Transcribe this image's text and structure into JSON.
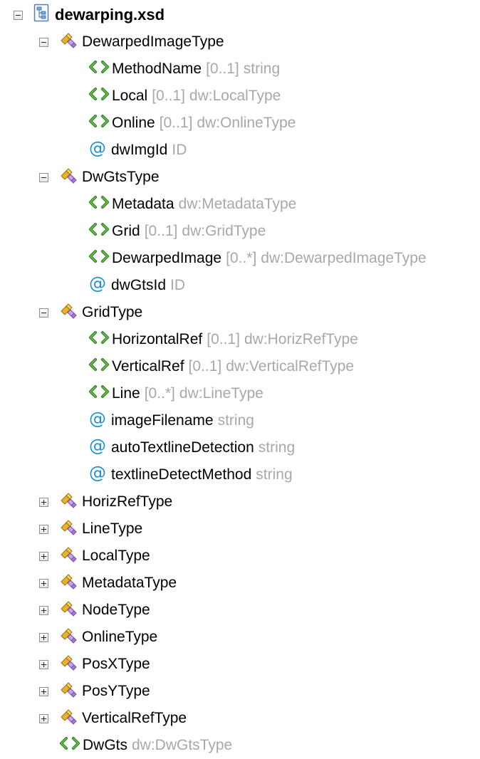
{
  "tree": {
    "root": {
      "label": "dewarping.xsd",
      "icon": "schema-file-icon"
    },
    "nodes": [
      {
        "level": 1,
        "kind": "type",
        "expander": "minus",
        "name": "DewarpedImageType",
        "mult": "",
        "type": ""
      },
      {
        "level": 2,
        "kind": "element",
        "expander": "",
        "name": "MethodName",
        "mult": "[0..1]",
        "type": "string"
      },
      {
        "level": 2,
        "kind": "element",
        "expander": "",
        "name": "Local",
        "mult": "[0..1]",
        "type": "dw:LocalType"
      },
      {
        "level": 2,
        "kind": "element",
        "expander": "",
        "name": "Online",
        "mult": "[0..1]",
        "type": "dw:OnlineType"
      },
      {
        "level": 2,
        "kind": "attribute",
        "expander": "",
        "name": "dwImgId",
        "mult": "",
        "type": "ID"
      },
      {
        "level": 1,
        "kind": "type",
        "expander": "minus",
        "name": "DwGtsType",
        "mult": "",
        "type": ""
      },
      {
        "level": 2,
        "kind": "element",
        "expander": "",
        "name": "Metadata",
        "mult": "",
        "type": "dw:MetadataType"
      },
      {
        "level": 2,
        "kind": "element",
        "expander": "",
        "name": "Grid",
        "mult": "[0..1]",
        "type": "dw:GridType"
      },
      {
        "level": 2,
        "kind": "element",
        "expander": "",
        "name": "DewarpedImage",
        "mult": "[0..*]",
        "type": "dw:DewarpedImageType"
      },
      {
        "level": 2,
        "kind": "attribute",
        "expander": "",
        "name": "dwGtsId",
        "mult": "",
        "type": "ID"
      },
      {
        "level": 1,
        "kind": "type",
        "expander": "minus",
        "name": "GridType",
        "mult": "",
        "type": ""
      },
      {
        "level": 2,
        "kind": "element",
        "expander": "",
        "name": "HorizontalRef",
        "mult": "[0..1]",
        "type": "dw:HorizRefType"
      },
      {
        "level": 2,
        "kind": "element",
        "expander": "",
        "name": "VerticalRef",
        "mult": "[0..1]",
        "type": "dw:VerticalRefType"
      },
      {
        "level": 2,
        "kind": "element",
        "expander": "",
        "name": "Line",
        "mult": "[0..*]",
        "type": "dw:LineType"
      },
      {
        "level": 2,
        "kind": "attribute",
        "expander": "",
        "name": "imageFilename",
        "mult": "",
        "type": "string"
      },
      {
        "level": 2,
        "kind": "attribute",
        "expander": "",
        "name": "autoTextlineDetection",
        "mult": "",
        "type": "string"
      },
      {
        "level": 2,
        "kind": "attribute",
        "expander": "",
        "name": "textlineDetectMethod",
        "mult": "",
        "type": "string"
      },
      {
        "level": 1,
        "kind": "type",
        "expander": "plus",
        "name": "HorizRefType",
        "mult": "",
        "type": ""
      },
      {
        "level": 1,
        "kind": "type",
        "expander": "plus",
        "name": "LineType",
        "mult": "",
        "type": ""
      },
      {
        "level": 1,
        "kind": "type",
        "expander": "plus",
        "name": "LocalType",
        "mult": "",
        "type": ""
      },
      {
        "level": 1,
        "kind": "type",
        "expander": "plus",
        "name": "MetadataType",
        "mult": "",
        "type": ""
      },
      {
        "level": 1,
        "kind": "type",
        "expander": "plus",
        "name": "NodeType",
        "mult": "",
        "type": ""
      },
      {
        "level": 1,
        "kind": "type",
        "expander": "plus",
        "name": "OnlineType",
        "mult": "",
        "type": ""
      },
      {
        "level": 1,
        "kind": "type",
        "expander": "plus",
        "name": "PosXType",
        "mult": "",
        "type": ""
      },
      {
        "level": 1,
        "kind": "type",
        "expander": "plus",
        "name": "PosYType",
        "mult": "",
        "type": ""
      },
      {
        "level": 1,
        "kind": "type",
        "expander": "plus",
        "name": "VerticalRefType",
        "mult": "",
        "type": ""
      },
      {
        "level": 1,
        "kind": "element",
        "expander": "",
        "name": "DwGts",
        "mult": "",
        "type": "dw:DwGtsType"
      }
    ]
  },
  "colors": {
    "text": "#000000",
    "meta": "#a8a8a8",
    "element_icon": "#2e7d22",
    "attribute_icon": "#1e8fd6",
    "type_icon_gold": "#d9a21e",
    "type_icon_purple": "#8a5bb8"
  }
}
